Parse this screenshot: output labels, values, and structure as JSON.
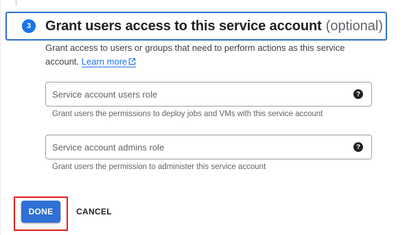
{
  "step": {
    "number": "3",
    "title": "Grant users access to this service account",
    "optional_label": "(optional)",
    "description": "Grant access to users or groups that need to perform actions as this service account.",
    "learn_more_label": "Learn more"
  },
  "fields": [
    {
      "placeholder": "Service account users role",
      "hint": "Grant users the permissions to deploy jobs and VMs with this service account",
      "help_icon_text": "?"
    },
    {
      "placeholder": "Service account admins role",
      "hint": "Grant users the permission to administer this service account",
      "help_icon_text": "?"
    }
  ],
  "actions": {
    "done_label": "DONE",
    "cancel_label": "CANCEL"
  },
  "colors": {
    "accent": "#1a73e8",
    "button": "#2f6fd6",
    "header_outline": "#2f6fc7",
    "highlight_outline": "#e21b1b"
  }
}
